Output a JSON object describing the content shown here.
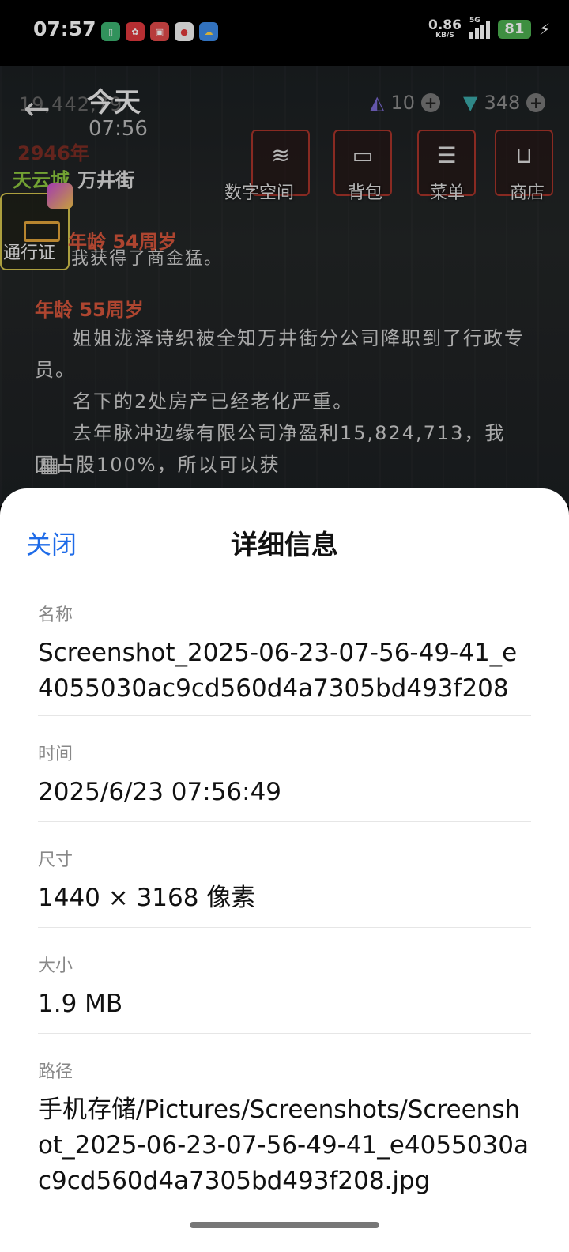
{
  "status_bar": {
    "time": "07:57",
    "net_speed": "0.86",
    "net_unit": "KB/S",
    "network": "5G",
    "battery": "81",
    "app_icons": [
      "sim-icon",
      "app-red-icon",
      "app-red2-icon",
      "map-pin-icon",
      "weather-icon"
    ]
  },
  "game": {
    "title": "今天",
    "time": "07:56",
    "money": "19,442,79",
    "year": "2946年",
    "resource_1": "10",
    "resource_2": "348",
    "city": "天云城",
    "street": "万井街",
    "menu": [
      "数字空间",
      "背包",
      "菜单",
      "商店"
    ],
    "pass_label": "通行证",
    "age_1": "年龄 54周岁",
    "fragment_1": "我获得了商金猛。",
    "age_2": "年龄 55周岁",
    "paragraphs": [
      "姐姐泷泽诗织被全知万井街分公司降职到了行政专员。",
      "名下的2处房产已经老化严重。",
      "去年脉冲边缘有限公司净盈利15,824,713，我因占股100%，所以可以获"
    ]
  },
  "sheet": {
    "close_label": "关闭",
    "title": "详细信息",
    "fields": [
      {
        "label": "名称",
        "value": "Screenshot_2025-06-23-07-56-49-41_e4055030ac9cd560d4a7305bd493f208"
      },
      {
        "label": "时间",
        "value": "2025/6/23 07:56:49"
      },
      {
        "label": "尺寸",
        "value": "1440 × 3168 像素"
      },
      {
        "label": "大小",
        "value": "1.9 MB"
      },
      {
        "label": "路径",
        "value": "手机存储/Pictures/Screenshots/Screenshot_2025-06-23-07-56-49-41_e4055030ac9cd560d4a7305bd493f208.jpg"
      }
    ]
  }
}
